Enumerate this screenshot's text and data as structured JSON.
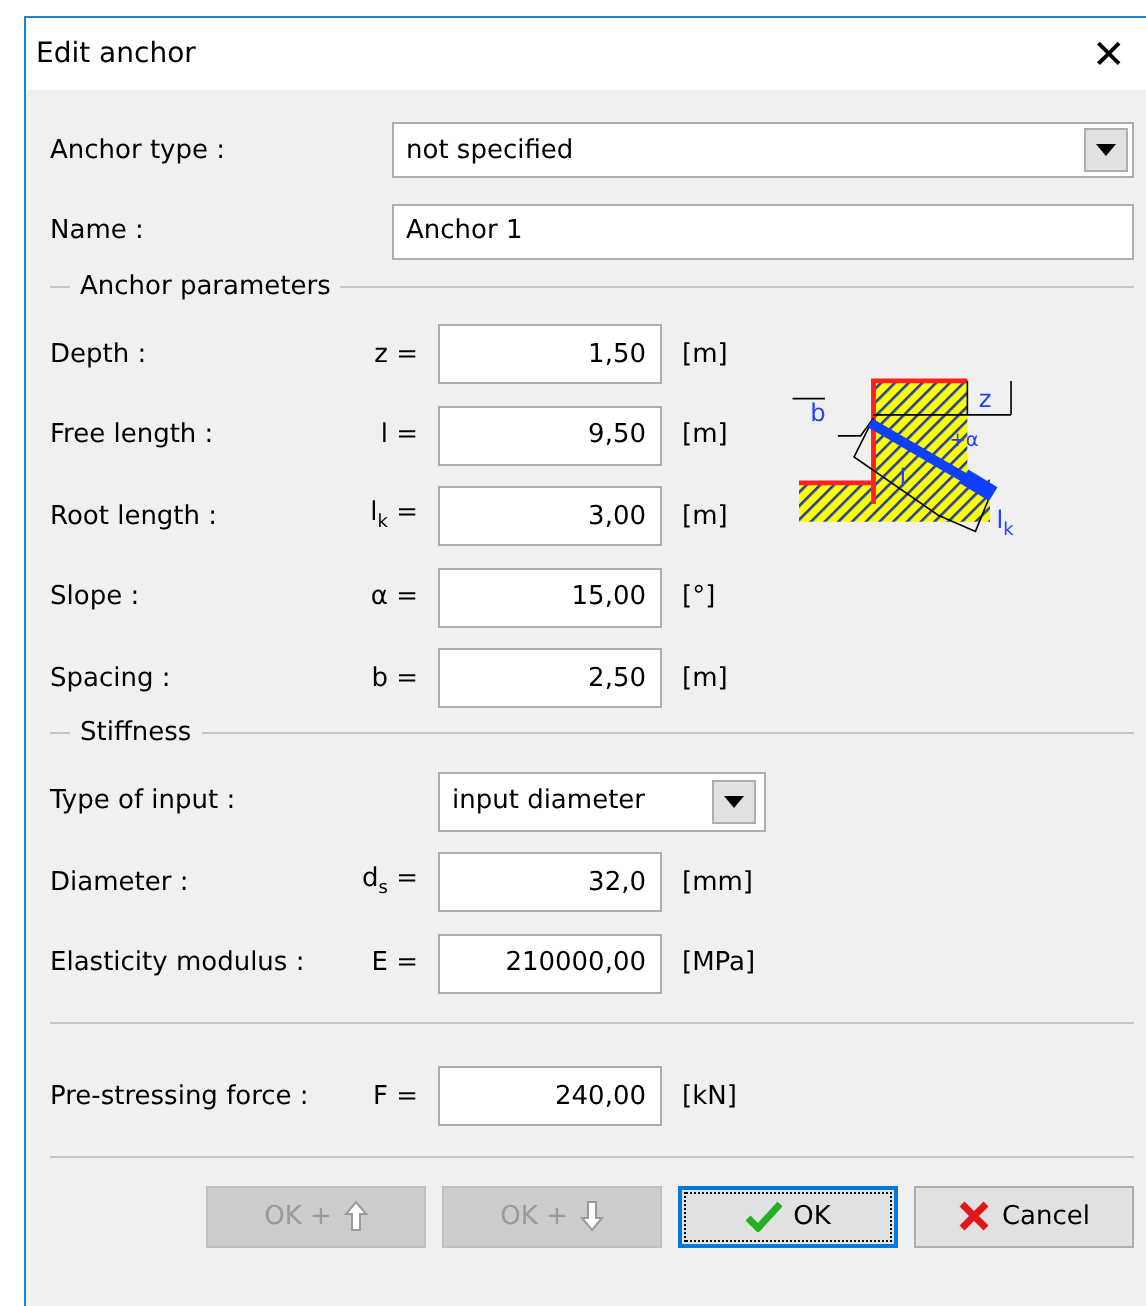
{
  "window": {
    "title": "Edit anchor",
    "close": "✕"
  },
  "anchor_type": {
    "label": "Anchor type :",
    "value": "not specified"
  },
  "name": {
    "label": "Name :",
    "value": "Anchor 1"
  },
  "anchor_parameters": {
    "title": "Anchor parameters",
    "rows": [
      {
        "label": "Depth :",
        "symbol": "z =",
        "value": "1,50",
        "unit": "[m]"
      },
      {
        "label": "Free length :",
        "symbol": "l =",
        "value": "9,50",
        "unit": "[m]"
      },
      {
        "label": "Root length :",
        "symbol": "l$_{k}$ =",
        "value": "3,00",
        "unit": "[m]"
      },
      {
        "label": "Slope :",
        "symbol": "α =",
        "value": "15,00",
        "unit": "[°]"
      },
      {
        "label": "Spacing :",
        "symbol": "b =",
        "value": "2,50",
        "unit": "[m]"
      }
    ]
  },
  "stiffness": {
    "title": "Stiffness",
    "type_of_input": {
      "label": "Type of input :",
      "value": "input diameter"
    },
    "rows": [
      {
        "label": "Diameter :",
        "symbol": "d$_{s}$ =",
        "value": "32,0",
        "unit": "[mm]"
      },
      {
        "label": "Elasticity modulus :",
        "symbol": "E =",
        "value": "210000,00",
        "unit": "[MPa]"
      }
    ]
  },
  "prestressing": {
    "label": "Pre-stressing force :",
    "symbol": "F =",
    "value": "240,00",
    "unit": "[kN]"
  },
  "diagram_labels": {
    "z": "z",
    "b": "b",
    "l": "l",
    "lk": "l$_{k}$",
    "alpha": "+α"
  },
  "buttons": [
    {
      "kind": "up",
      "label": "OK +",
      "disabled": true,
      "focused": false
    },
    {
      "kind": "down",
      "label": "OK +",
      "disabled": true,
      "focused": false
    },
    {
      "kind": "ok",
      "label": "OK",
      "disabled": false,
      "focused": true
    },
    {
      "kind": "cancel",
      "label": "Cancel",
      "disabled": false,
      "focused": false
    }
  ]
}
